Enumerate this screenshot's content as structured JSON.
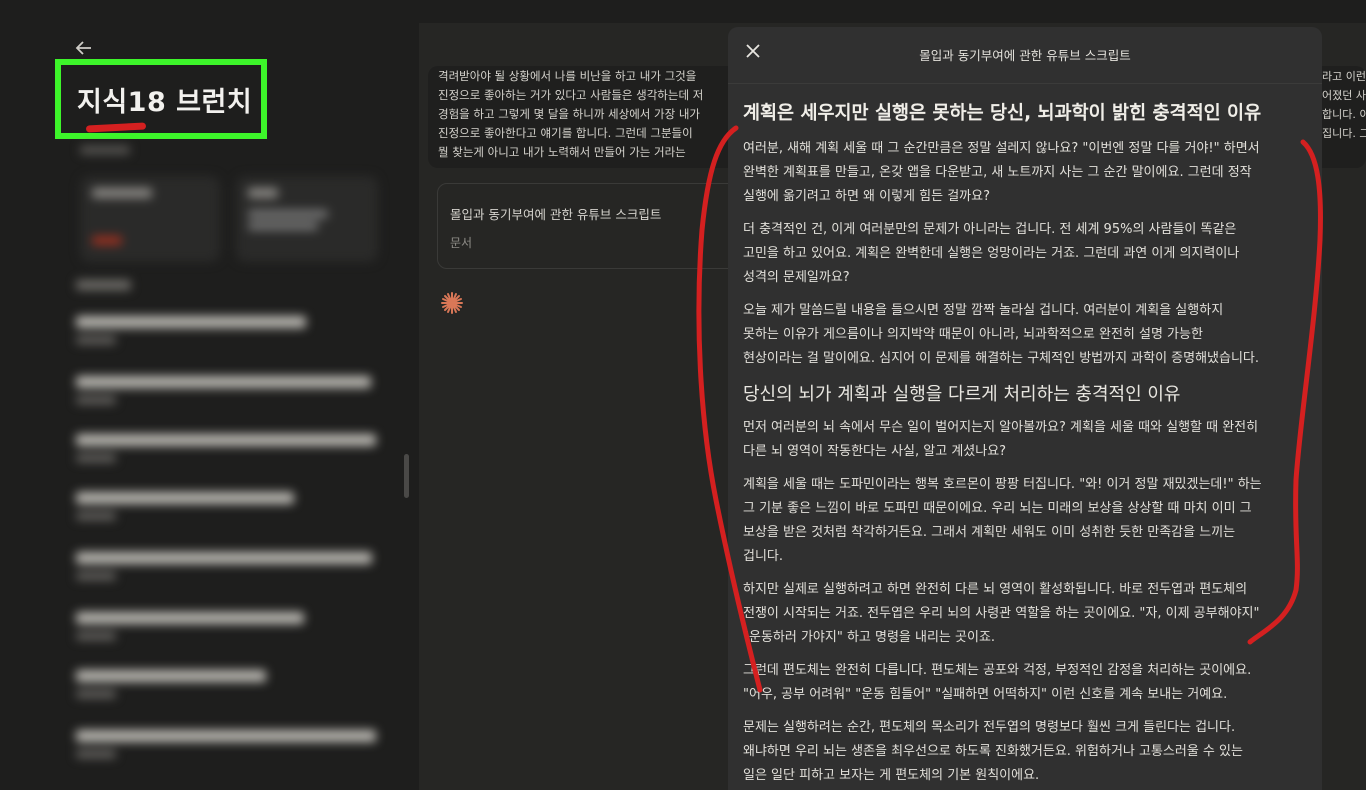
{
  "sidebar": {
    "back_icon": "arrow-left-icon",
    "brand": "지식18 브런치"
  },
  "main": {
    "message_lines": [
      "격려받아야 될 상황에서 나를 비난을 하고 내가 그것을",
      "진정으로 좋아하는 거가 있다고 사람들은 생각하는데 저",
      "경험을 하고 그렇게 몇 달을 하니까 세상에서 가장 내가",
      "진정으로 좋아한다고 얘기를 합니다. 그런데 그분들이",
      "뭘 찾는게 아니고 내가 노력해서 만들어 가는 거라는"
    ],
    "message_right_lines": [
      "라고 이런",
      "어졌던 사",
      "합니다. 이",
      "집니다. 그"
    ],
    "attachment": {
      "title": "몰입과 동기부여에 관한 유튜브 스크립트",
      "type": "문서"
    },
    "spark_icon": "sparkle-icon"
  },
  "panel": {
    "title": "몰입과 동기부여에 관한 유튜브 스크립트",
    "close_icon": "close-icon",
    "heading": "계획은 세우지만 실행은 못하는 당신, 뇌과학이 밝힌 충격적인 이유",
    "paragraphs_a": [
      [
        "여러분, 새해 계획 세울 때 그 순간만큼은 정말 설레지 않나요? \"이번엔 정말 다를 거야!\" 하면서",
        "완벽한 계획표를 만들고, 온갖 앱을 다운받고, 새 노트까지 사는 그 순간 말이에요. 그런데 정작",
        "실행에 옮기려고 하면 왜 이렇게 힘든 걸까요?"
      ],
      [
        "더 충격적인 건, 이게 여러분만의 문제가 아니라는 겁니다. 전 세계 95%의 사람들이 똑같은",
        "고민을 하고 있어요. 계획은 완벽한데 실행은 엉망이라는 거죠. 그런데 과연 이게 의지력이나",
        "성격의 문제일까요?"
      ],
      [
        "오늘 제가 말씀드릴 내용을 들으시면 정말 깜짝 놀라실 겁니다. 여러분이 계획을 실행하지",
        "못하는 이유가 게으름이나 의지박약 때문이 아니라, 뇌과학적으로 완전히 설명 가능한",
        "현상이라는 걸 말이에요. 심지어 이 문제를 해결하는 구체적인 방법까지 과학이 증명해냈습니다."
      ]
    ],
    "subheading": "당신의 뇌가 계획과 실행을 다르게 처리하는 충격적인 이유",
    "paragraphs_b": [
      [
        "먼저 여러분의 뇌 속에서 무슨 일이 벌어지는지 알아볼까요? 계획을 세울 때와 실행할 때 완전히",
        "다른 뇌 영역이 작동한다는 사실, 알고 계셨나요?"
      ],
      [
        "계획을 세울 때는 도파민이라는 행복 호르몬이 팡팡 터집니다. \"와! 이거 정말 재밌겠는데!\" 하는",
        "그 기분 좋은 느낌이 바로 도파민 때문이에요. 우리 뇌는 미래의 보상을 상상할 때 마치 이미 그",
        "보상을 받은 것처럼 착각하거든요. 그래서 계획만 세워도 이미 성취한 듯한 만족감을 느끼는",
        "겁니다."
      ],
      [
        "하지만 실제로 실행하려고 하면 완전히 다른 뇌 영역이 활성화됩니다. 바로 전두엽과 편도체의",
        "전쟁이 시작되는 거죠. 전두엽은 우리 뇌의 사령관 역할을 하는 곳이에요. \"자, 이제 공부해야지\"",
        "\"운동하러 가야지\" 하고 명령을 내리는 곳이죠."
      ],
      [
        "그런데 편도체는 완전히 다릅니다. 편도체는 공포와 걱정, 부정적인 감정을 처리하는 곳이에요.",
        "\"어우, 공부 어려워\" \"운동 힘들어\" \"실패하면 어떡하지\" 이런 신호를 계속 보내는 거예요."
      ],
      [
        "문제는 실행하려는 순간, 편도체의 목소리가 전두엽의 명령보다 훨씬 크게 들린다는 겁니다.",
        "왜냐하면 우리 뇌는 생존을 최우선으로 하도록 진화했거든요. 위험하거나 고통스러울 수 있는",
        "일은 일단 피하고 보자는 게 편도체의 기본 원칙이에요."
      ]
    ]
  },
  "colors": {
    "highlight_box": "#3df52a",
    "annotation_ink": "#d42020",
    "accent": "#d97757"
  }
}
